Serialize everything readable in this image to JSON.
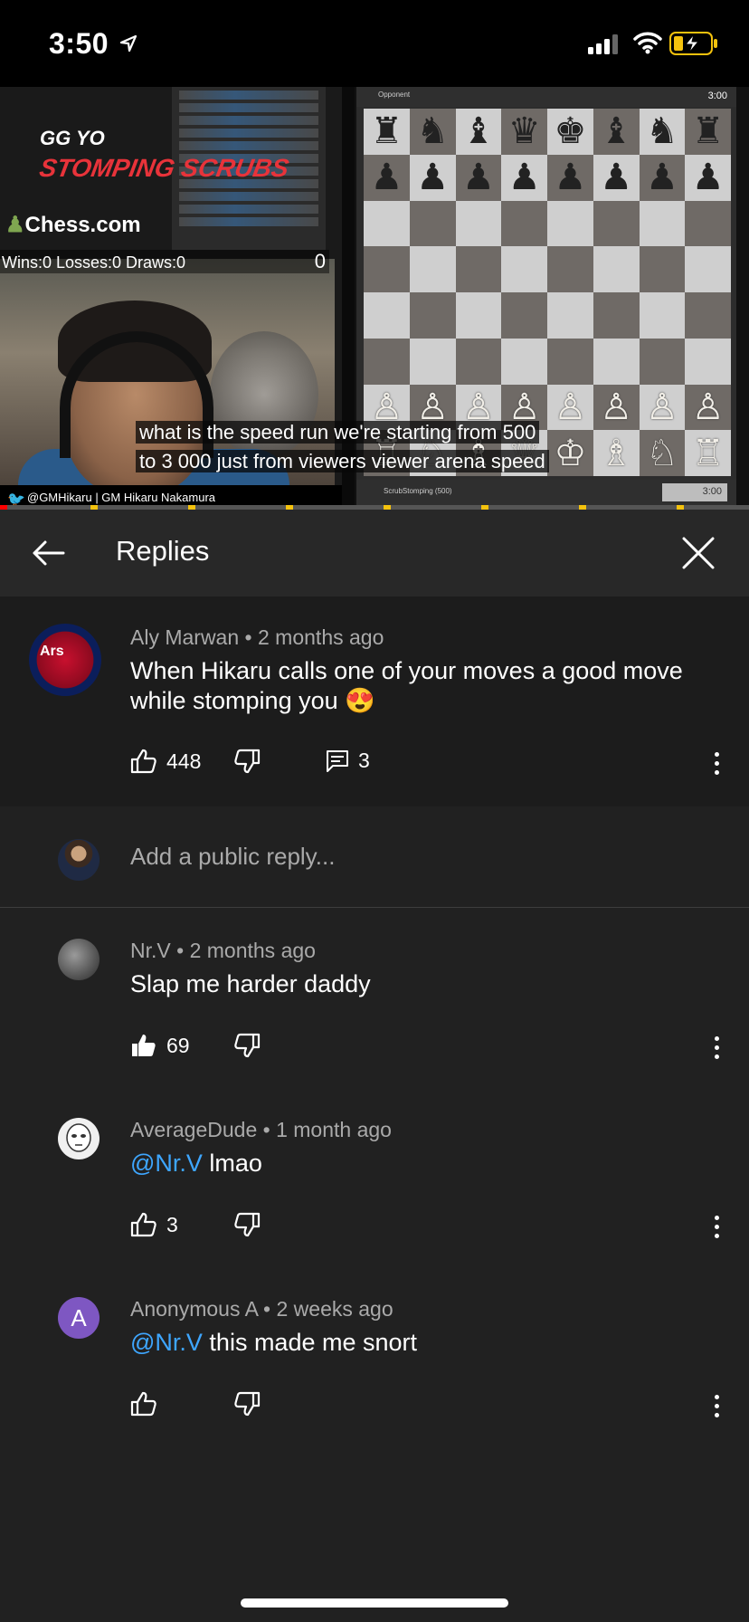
{
  "status_bar": {
    "time": "3:50"
  },
  "video": {
    "logo_top": "GG YO",
    "logo_main": "STOMPING SCRUBS",
    "logo_brand": "Chess.com",
    "score_text": "Wins:0 Losses:0 Draws:0",
    "score_number": "0",
    "handle_text": "@GMHikaru | GM Hikaru Nakamura",
    "board_top_label": "Opponent",
    "board_top_time": "3:00",
    "board_bottom_label": "ScrubStomping (500)",
    "board_bottom_time": "3:00",
    "caption_line1": "what is the speed run we're starting from 500",
    "caption_line2": "to 3 000 just from viewers viewer arena speed",
    "progress_fraction": 0.01,
    "board_rows": [
      [
        "♜",
        "♞",
        "♝",
        "♛",
        "♚",
        "♝",
        "♞",
        "♜"
      ],
      [
        "♟",
        "♟",
        "♟",
        "♟",
        "♟",
        "♟",
        "♟",
        "♟"
      ],
      [
        "",
        "",
        "",
        "",
        "",
        "",
        "",
        ""
      ],
      [
        "",
        "",
        "",
        "",
        "",
        "",
        "",
        ""
      ],
      [
        "",
        "",
        "",
        "",
        "",
        "",
        "",
        ""
      ],
      [
        "",
        "",
        "",
        "",
        "",
        "",
        "",
        ""
      ],
      [
        "♙",
        "♙",
        "♙",
        "♙",
        "♙",
        "♙",
        "♙",
        "♙"
      ],
      [
        "♖",
        "♘",
        "♗",
        "♕",
        "♔",
        "♗",
        "♘",
        "♖"
      ]
    ]
  },
  "header": {
    "title": "Replies"
  },
  "main_comment": {
    "author": "Aly Marwan",
    "time": "2 months ago",
    "text": "When Hikaru calls one of your moves a good move while stomping you 😍",
    "likes": "448",
    "replies": "3"
  },
  "reply_input": {
    "placeholder": "Add a public reply..."
  },
  "replies": [
    {
      "author": "Nr.V",
      "time": "2 months ago",
      "mention": "",
      "text": "Slap me harder daddy",
      "likes": "69",
      "liked": true
    },
    {
      "author": "AverageDude",
      "time": "1 month ago",
      "mention": "@Nr.V",
      "text": " lmao",
      "likes": "3",
      "liked": false
    },
    {
      "author": "Anonymous A",
      "time": "2 weeks ago",
      "mention": "@Nr.V",
      "text": " this made me snort",
      "likes": "",
      "liked": false,
      "avatar_letter": "A"
    }
  ],
  "colors": {
    "background": "#212121",
    "mention": "#3ea6ff",
    "progress": "#ff0000",
    "anon_avatar": "#7e57c2"
  }
}
